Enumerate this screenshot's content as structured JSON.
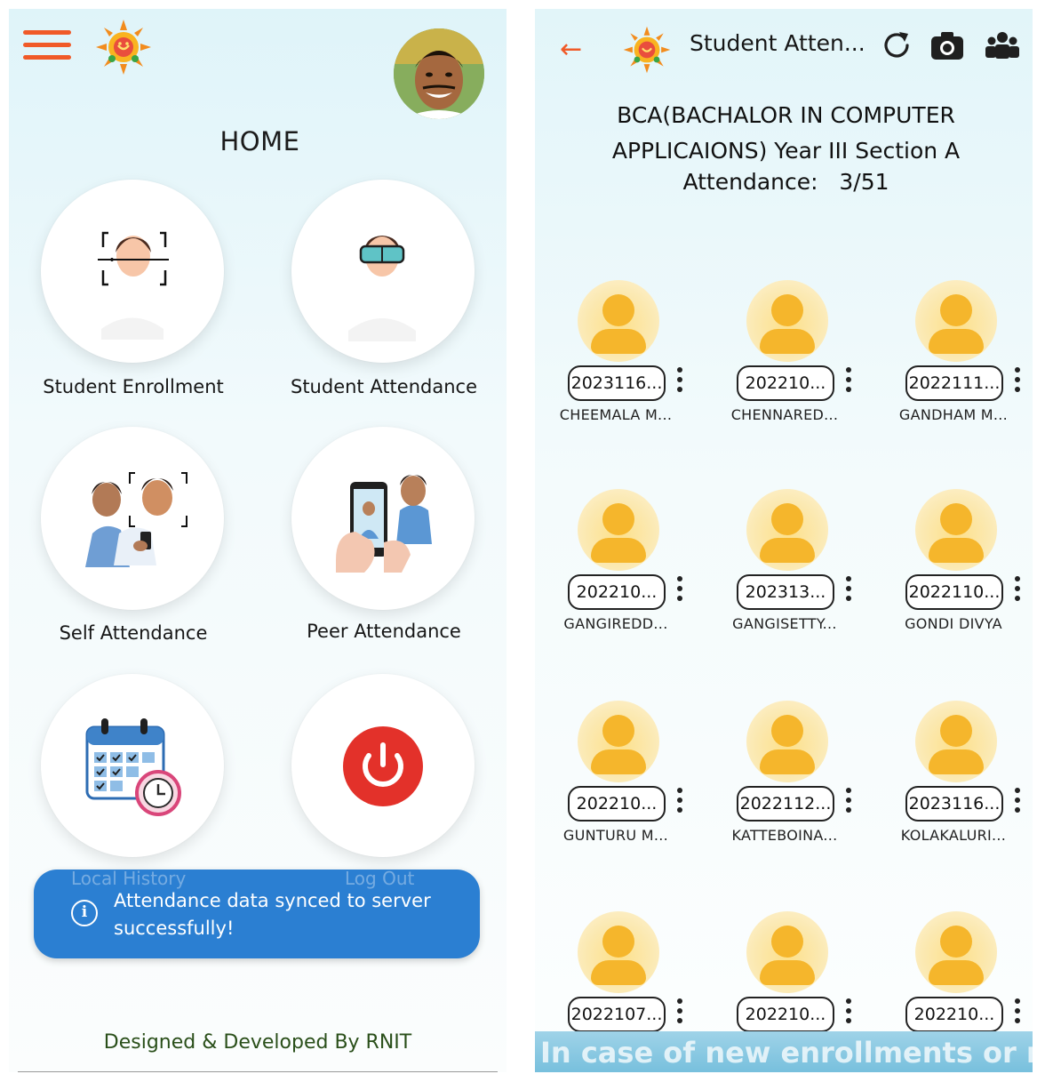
{
  "home": {
    "title": "HOME",
    "tiles": [
      {
        "label": "Student Enrollment",
        "icon": "face-scan-icon"
      },
      {
        "label": "Student Attendance",
        "icon": "vr-headset-person-icon"
      },
      {
        "label": "Self Attendance",
        "icon": "self-face-verify-icon"
      },
      {
        "label": "Peer Attendance",
        "icon": "phone-photo-peer-icon"
      },
      {
        "label": "Local History",
        "icon": "calendar-clock-icon"
      },
      {
        "label": "Log Out",
        "icon": "power-icon"
      }
    ],
    "toast": {
      "text": "Attendance data synced to server successfully!",
      "icon": "info-icon"
    },
    "footer": "Designed & Developed By RNIT",
    "colors": {
      "accent": "#f05a28",
      "toast": "#2b7fd2",
      "power": "#e3312a"
    }
  },
  "attendance": {
    "title": "Student Atten...",
    "class_line1": "BCA(BACHALOR IN COMPUTER",
    "class_line2": "APPLICAIONS) Year III  Section A",
    "attendance_label": "Attendance:",
    "attendance_value": "3/51",
    "students": [
      {
        "id": "2023116...",
        "name": "CHEEMALA M..."
      },
      {
        "id": "202210...",
        "name": "CHENNARED..."
      },
      {
        "id": "2022111...",
        "name": "GANDHAM M..."
      },
      {
        "id": "202210...",
        "name": "GANGIREDD..."
      },
      {
        "id": "202313...",
        "name": "GANGISETTY..."
      },
      {
        "id": "2022110...",
        "name": "GONDI DIVYA"
      },
      {
        "id": "202210...",
        "name": "GUNTURU M..."
      },
      {
        "id": "2022112...",
        "name": "KATTEBOINA..."
      },
      {
        "id": "2023116...",
        "name": "KOLAKALURI..."
      },
      {
        "id": "2022107...",
        "name": ""
      },
      {
        "id": "202210...",
        "name": ""
      },
      {
        "id": "202210...",
        "name": ""
      }
    ],
    "banner": "In case of new enrollments or m"
  }
}
